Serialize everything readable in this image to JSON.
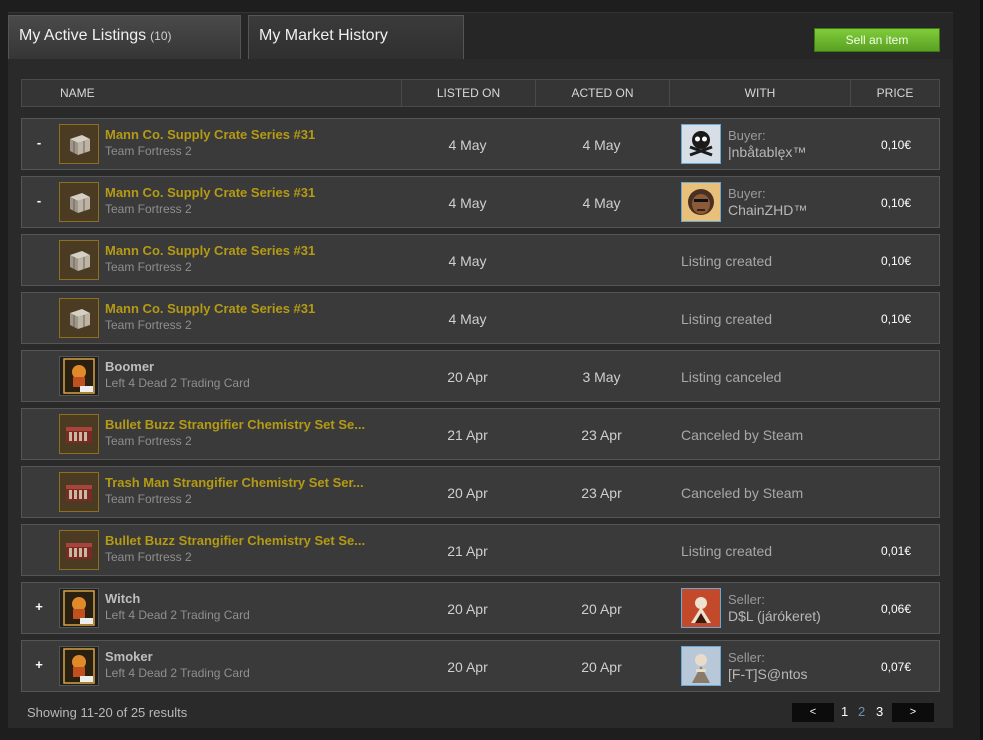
{
  "tabs": [
    {
      "label": "My Active Listings",
      "count": "(10)"
    },
    {
      "label": "My Market History"
    }
  ],
  "sell_button": "Sell an item",
  "columns": [
    "NAME",
    "LISTED ON",
    "ACTED ON",
    "WITH",
    "PRICE"
  ],
  "rows": [
    {
      "toggle": "-",
      "name": "Mann Co. Supply Crate Series #31",
      "game": "Team Fortress 2",
      "listed": "4 May",
      "acted": "4 May",
      "with_role": "Buyer:",
      "with_name": "|nbåtablęx™",
      "price": "0,10€",
      "thumb": "crate-icon",
      "avatar": "skull-avatar"
    },
    {
      "toggle": "-",
      "name": "Mann Co. Supply Crate Series #31",
      "game": "Team Fortress 2",
      "listed": "4 May",
      "acted": "4 May",
      "with_role": "Buyer:",
      "with_name": "ChainZHD™",
      "price": "0,10€",
      "thumb": "crate-icon",
      "avatar": "face-avatar"
    },
    {
      "toggle": "",
      "name": "Mann Co. Supply Crate Series #31",
      "game": "Team Fortress 2",
      "listed": "4 May",
      "acted": "",
      "with_text": "Listing created",
      "price": "0,10€",
      "thumb": "crate-icon"
    },
    {
      "toggle": "",
      "name": "Mann Co. Supply Crate Series #31",
      "game": "Team Fortress 2",
      "listed": "4 May",
      "acted": "",
      "with_text": "Listing created",
      "price": "0,10€",
      "thumb": "crate-icon"
    },
    {
      "toggle": "",
      "name": "Boomer",
      "game": "Left 4 Dead 2 Trading Card",
      "listed": "20 Apr",
      "acted": "3 May",
      "with_text": "Listing canceled",
      "price": "",
      "thumb": "l4d2-card-icon",
      "gray": true
    },
    {
      "toggle": "",
      "name": "Bullet Buzz Strangifier Chemistry Set Se...",
      "game": "Team Fortress 2",
      "listed": "21 Apr",
      "acted": "23 Apr",
      "with_text": "Canceled by Steam",
      "price": "",
      "thumb": "chemistry-set-icon"
    },
    {
      "toggle": "",
      "name": "Trash Man Strangifier Chemistry Set Ser...",
      "game": "Team Fortress 2",
      "listed": "20 Apr",
      "acted": "23 Apr",
      "with_text": "Canceled by Steam",
      "price": "",
      "thumb": "chemistry-set-icon"
    },
    {
      "toggle": "",
      "name": "Bullet Buzz Strangifier Chemistry Set Se...",
      "game": "Team Fortress 2",
      "listed": "21 Apr",
      "acted": "",
      "with_text": "Listing created",
      "price": "0,01€",
      "thumb": "chemistry-set-icon"
    },
    {
      "toggle": "+",
      "name": "Witch",
      "game": "Left 4 Dead 2 Trading Card",
      "listed": "20 Apr",
      "acted": "20 Apr",
      "with_role": "Seller:",
      "with_name": "D$L (járókeret)",
      "price": "0,06€",
      "thumb": "l4d2-card-icon",
      "avatar": "red-avatar",
      "gray": true
    },
    {
      "toggle": "+",
      "name": "Smoker",
      "game": "Left 4 Dead 2 Trading Card",
      "listed": "20 Apr",
      "acted": "20 Apr",
      "with_role": "Seller:",
      "with_name": "[F-T]S@ntos",
      "price": "0,07€",
      "thumb": "l4d2-card-icon",
      "avatar": "figure-avatar",
      "gray": true
    }
  ],
  "footer": {
    "showing": "Showing 11-20 of 25 results",
    "prev": "<",
    "next": ">",
    "pages": [
      "1",
      "2",
      "3"
    ]
  },
  "colors": {
    "item_name": "#b59a14",
    "sell_button": "#6bb82e",
    "avatar_border": "#6aa8d8"
  }
}
